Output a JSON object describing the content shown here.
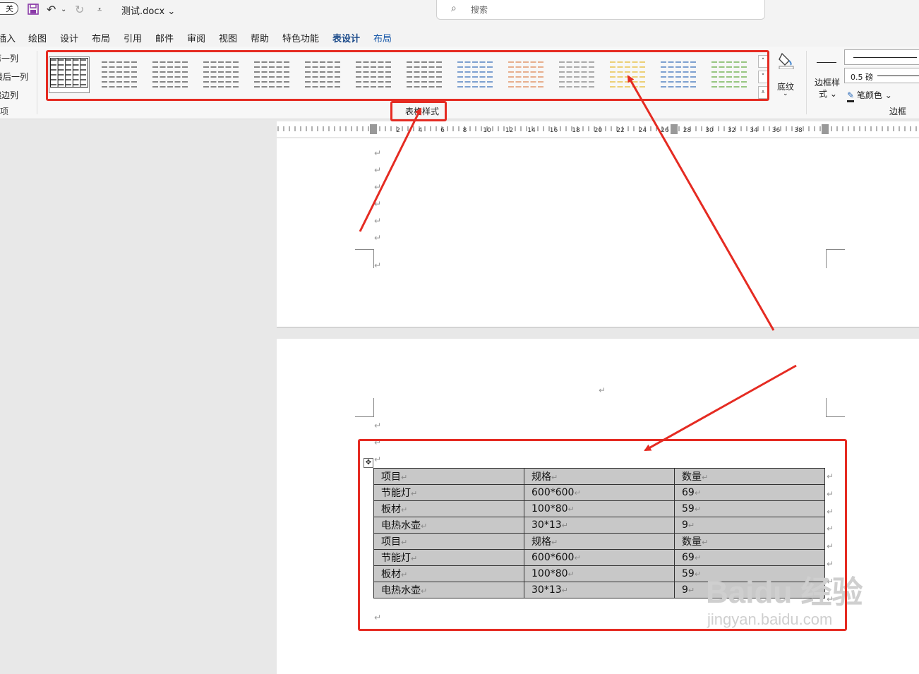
{
  "title_bar": {
    "autosave": "关",
    "filename": "测试.docx",
    "search_placeholder": "搜索"
  },
  "tabs": [
    "插入",
    "绘图",
    "设计",
    "布局",
    "引用",
    "邮件",
    "审阅",
    "视图",
    "帮助",
    "特色功能",
    "表设计",
    "布局"
  ],
  "active_tab": "表设计",
  "ribbon": {
    "style_options": [
      "第一列",
      "最后一列",
      "镶边列",
      "选项"
    ],
    "table_styles_group": "表格样式",
    "shading_label": "底纹",
    "border_styles_label_1": "边框样",
    "border_styles_label_2": "式",
    "pen_weight": "0.5 磅",
    "pen_color_label": "笔颜色",
    "borders_group": "边框"
  },
  "ruler_ticks": [
    "2",
    "4",
    "6",
    "8",
    "10",
    "12",
    "14",
    "16",
    "18",
    "20",
    "22",
    "24",
    "26",
    "28",
    "30",
    "32",
    "34",
    "36",
    "38"
  ],
  "paragraph_mark": "↵",
  "table": {
    "rows": [
      [
        "项目",
        "规格",
        "数量"
      ],
      [
        "节能灯",
        "600*600",
        "69"
      ],
      [
        "板材",
        "100*80",
        "59"
      ],
      [
        "电热水壶",
        "30*13",
        "9"
      ],
      [
        "项目",
        "规格",
        "数量"
      ],
      [
        "节能灯",
        "600*600",
        "69"
      ],
      [
        "板材",
        "100*80",
        "59"
      ],
      [
        "电热水壶",
        "30*13",
        "9"
      ]
    ]
  },
  "watermark": {
    "line1": "Baidu 经验",
    "line2": "jingyan.baidu.com"
  },
  "annotation_color": "#e52b22",
  "gallery_colors": [
    "#222222",
    "#555555",
    "#555555",
    "#555555",
    "#555555",
    "#555555",
    "#555555",
    "#555555",
    "#4a7cc0",
    "#e09060",
    "#888888",
    "#e8c040",
    "#4a7cc0",
    "#70b050"
  ]
}
